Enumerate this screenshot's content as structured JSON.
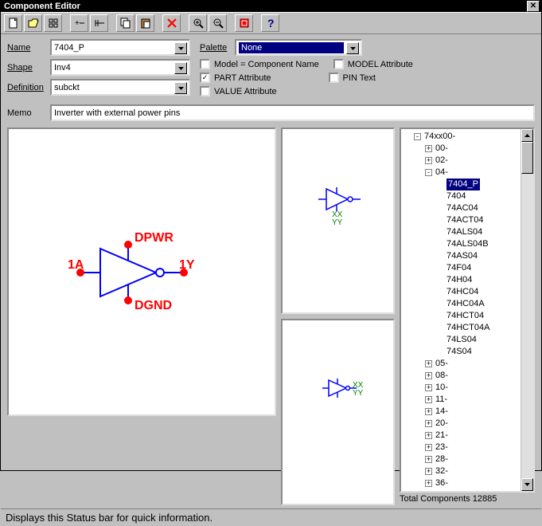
{
  "title": "Component Editor",
  "toolbar_icons": [
    "new",
    "open",
    "component",
    "add-pin",
    "remove-pin",
    "copy",
    "paste",
    "delete",
    "zoom-in",
    "zoom-out",
    "library",
    "help"
  ],
  "form": {
    "name_label": "Name",
    "name_value": "7404_P",
    "shape_label": "Shape",
    "shape_value": "Inv4",
    "definition_label": "Definition",
    "definition_value": "subckt",
    "palette_label": "Palette",
    "palette_value": "None",
    "checks": {
      "model_component_name": {
        "label": "Model = Component Name",
        "checked": false
      },
      "model_attribute": {
        "label": "MODEL Attribute",
        "checked": false
      },
      "part_attribute": {
        "label": "PART Attribute",
        "checked": true
      },
      "pin_text": {
        "label": "PIN Text",
        "checked": false
      },
      "value_attribute": {
        "label": "VALUE Attribute",
        "checked": false
      }
    },
    "memo_label": "Memo",
    "memo_value": "Inverter with external power pins"
  },
  "preview": {
    "pin_1a": "1A",
    "pin_dpwr": "DPWR",
    "pin_1y": "1Y",
    "pin_dgnd": "DGND",
    "xx": "XX",
    "yy": "YY"
  },
  "tree": {
    "root": "74xx00-",
    "groups_before": [
      "00-",
      "02-"
    ],
    "open_group": "04-",
    "items": [
      "7404_P",
      "7404",
      "74AC04",
      "74ACT04",
      "74ALS04",
      "74ALS04B",
      "74AS04",
      "74F04",
      "74H04",
      "74HC04",
      "74HC04A",
      "74HCT04",
      "74HCT04A",
      "74LS04",
      "74S04"
    ],
    "selected": "7404_P",
    "groups_after": [
      "05-",
      "08-",
      "10-",
      "11-",
      "14-",
      "20-",
      "21-",
      "23-",
      "28-",
      "32-",
      "36-"
    ]
  },
  "total_label": "Total Components 12885",
  "status": "Displays this Status bar for quick information."
}
